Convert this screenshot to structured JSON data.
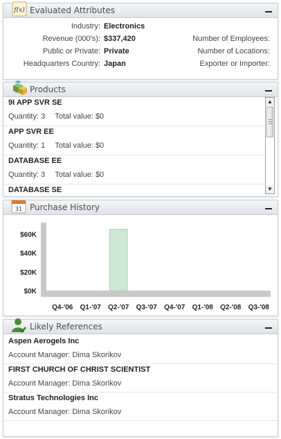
{
  "attributes": {
    "title": "Evaluated Attributes",
    "icon": "function-icon",
    "left": [
      {
        "label": "Industry:",
        "value": "Electronics"
      },
      {
        "label": "Revenue (000's):",
        "value": "$337,420"
      },
      {
        "label": "Public or Private:",
        "value": "Private"
      },
      {
        "label": "Headquarters Country:",
        "value": "Japan"
      }
    ],
    "right": [
      {
        "label": "Number of Employees:"
      },
      {
        "label": "Number of Locations:"
      },
      {
        "label": "Exporter or Importer:"
      }
    ]
  },
  "products": {
    "title": "Products",
    "icon": "cubes-icon",
    "quantity_label": "Quantity:",
    "total_label": "Total value:",
    "items": [
      {
        "name": "9I APP SVR SE",
        "quantity": "3",
        "total": "$0"
      },
      {
        "name": "APP SVR EE",
        "quantity": "1",
        "total": "$0"
      },
      {
        "name": "DATABASE EE",
        "quantity": "3",
        "total": "$0"
      },
      {
        "name": "DATABASE SE",
        "quantity": "",
        "total": ""
      }
    ]
  },
  "history": {
    "title": "Purchase History",
    "icon": "calendar-icon",
    "chart_data": {
      "type": "bar",
      "categories": [
        "Q4-'06",
        "Q1-'07",
        "Q2-'07",
        "Q3-'07",
        "Q4-'07",
        "Q1-'08",
        "Q2-'08",
        "Q3-'08"
      ],
      "series": [
        {
          "values": [
            0,
            0,
            65,
            0,
            0,
            0,
            0,
            0
          ]
        }
      ],
      "ytick_labels": [
        "$60K",
        "$40K",
        "$20K",
        "$0K"
      ],
      "yticks": [
        60,
        40,
        20,
        0
      ],
      "ylim": [
        0,
        72
      ],
      "unit": "$K",
      "bar_color": "#cfe8d4",
      "grid": false,
      "legend": "none"
    }
  },
  "references": {
    "title": "Likely References",
    "icon": "person-check-icon",
    "manager_label": "Account Manager:",
    "items": [
      {
        "name": "Aspen Aerogels Inc",
        "manager": "Dima Skorikov"
      },
      {
        "name": "FIRST CHURCH OF CHRIST SCIENTIST",
        "manager": "Dima Skorikov"
      },
      {
        "name": "Stratus Technologies Inc",
        "manager": "Dima Skorikov"
      }
    ]
  }
}
